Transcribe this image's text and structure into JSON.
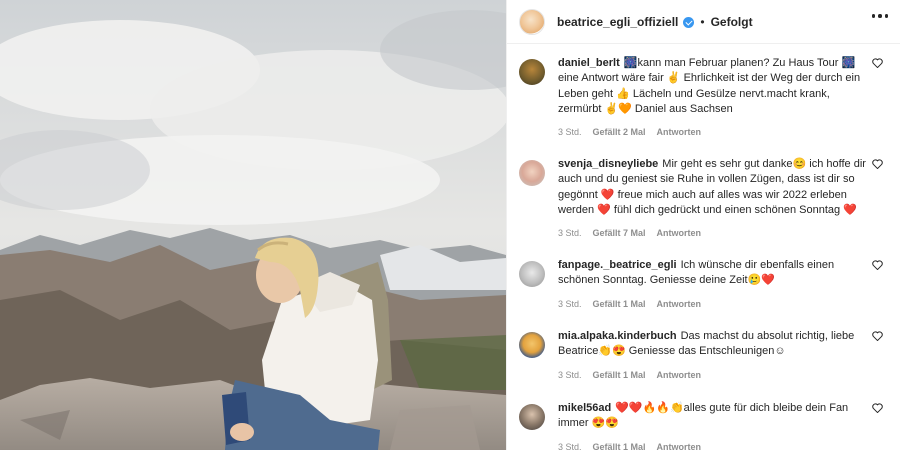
{
  "post": {
    "username": "beatrice_egli_offiziell",
    "separator": "•",
    "follow_label": "Gefolgt"
  },
  "comments": [
    {
      "user": "daniel_berlt",
      "text": "🎆kann man Februar planen? Zu Haus Tour 🎆 eine Antwort wäre fair ✌ Ehrlichkeit ist der Weg der durch ein Leben geht 👍 Lächeln und Gesülze nervt.macht krank, zermürbt ✌🧡 Daniel aus Sachsen",
      "time": "3 Std.",
      "likes": "Gefällt 2 Mal",
      "reply": "Antworten"
    },
    {
      "user": "svenja_disneyliebe",
      "text": "Mir geht es sehr gut danke😊 ich hoffe dir auch und du geniest sie Ruhe in vollen Zügen, dass ist dir so gegönnt ❤️ freue mich auch auf alles was wir 2022 erleben werden ❤️ fühl dich gedrückt und einen schönen Sonntag ❤️",
      "time": "3 Std.",
      "likes": "Gefällt 7 Mal",
      "reply": "Antworten"
    },
    {
      "user": "fanpage._beatrice_egli",
      "text": "Ich wünsche dir ebenfalls einen schönen Sonntag. Geniesse deine Zeit🥲❤️",
      "time": "3 Std.",
      "likes": "Gefällt 1 Mal",
      "reply": "Antworten"
    },
    {
      "user": "mia.alpaka.kinderbuch",
      "text": "Das machst du absolut richtig, liebe Beatrice👏😍 Geniesse das Entschleunigen☺",
      "time": "3 Std.",
      "likes": "Gefällt 1 Mal",
      "reply": "Antworten"
    },
    {
      "user": "mikel56ad",
      "text": "❤️❤️🔥🔥👏alles gute für dich bleibe dein Fan immer 😍😍",
      "time": "3 Std.",
      "likes": "Gefällt 1 Mal",
      "reply": "Antworten"
    }
  ],
  "colors": {
    "accent_verified": "#3897f0",
    "text": "#262626",
    "meta": "#8e8e8e"
  }
}
